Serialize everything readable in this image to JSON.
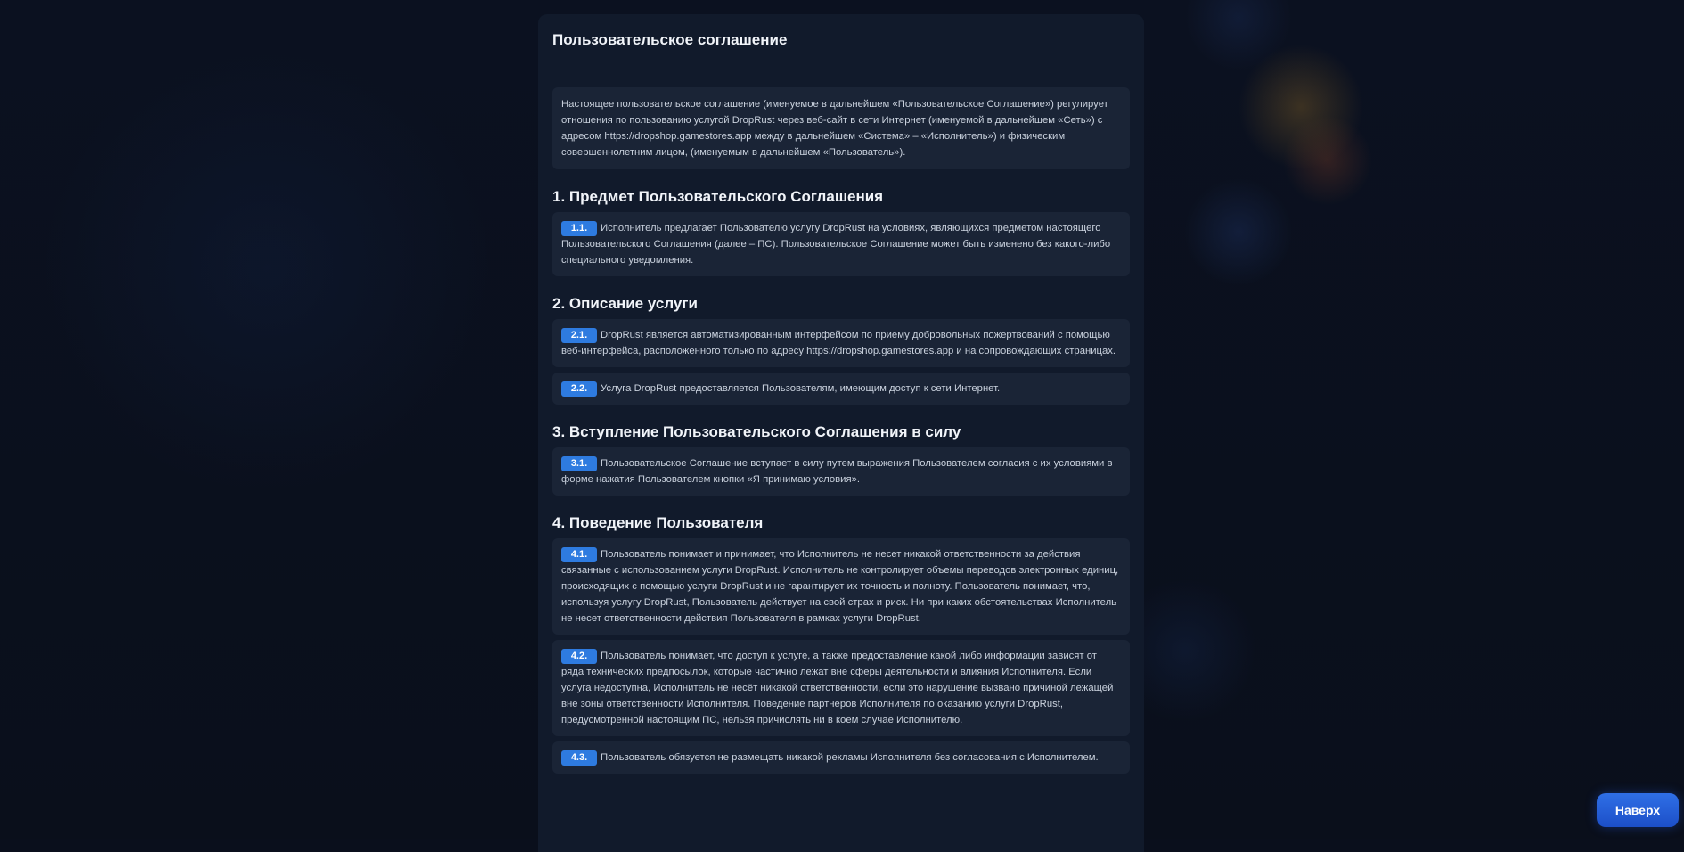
{
  "page": {
    "title": "Пользовательское соглашение",
    "intro": "Настоящее пользовательское соглашение (именуемое в дальнейшем «Пользовательское Соглашение») регулирует отношения по пользованию услугой DropRust через веб-сайт в сети Интернет (именуемой в дальнейшем «Сеть») с адресом https://dropshop.gamestores.app между в дальнейшем «Система» – «Исполнитель») и физическим совершеннолетним лицом, (именуемым в дальнейшем «Пользователь»)."
  },
  "sections": [
    {
      "title": "1. Предмет Пользовательского Соглашения",
      "items": [
        {
          "num": "1.1.",
          "text": "Исполнитель предлагает Пользователю услугу DropRust на условиях, являющихся предметом настоящего Пользовательского Соглашения (далее – ПС). Пользовательское Соглашение может быть изменено без какого-либо специального уведомления."
        }
      ]
    },
    {
      "title": "2. Описание услуги",
      "items": [
        {
          "num": "2.1.",
          "text": "DropRust является автоматизированным интерфейсом по приему добровольных пожертвований с помощью веб-интерфейса, расположенного только по адресу https://dropshop.gamestores.app и на сопровождающих страницах."
        },
        {
          "num": "2.2.",
          "text": "Услуга DropRust предоставляется Пользователям, имеющим доступ к сети Интернет."
        }
      ]
    },
    {
      "title": "3. Вступление Пользовательского Соглашения в силу",
      "items": [
        {
          "num": "3.1.",
          "text": "Пользовательское Соглашение вступает в силу путем выражения Пользователем согласия с их условиями в форме нажатия Пользователем кнопки «Я принимаю условия»."
        }
      ]
    },
    {
      "title": "4. Поведение Пользователя",
      "items": [
        {
          "num": "4.1.",
          "text": "Пользователь понимает и принимает, что Исполнитель не несет никакой ответственности за действия связанные с использованием услуги DropRust. Исполнитель не контролирует объемы переводов электронных единиц, происходящих с помощью услуги DropRust и не гарантирует их точность и полноту. Пользователь понимает, что, используя услугу DropRust, Пользователь действует на свой страх и риск. Ни при каких обстоятельствах Исполнитель не несет ответственности действия Пользователя в рамках услуги DropRust."
        },
        {
          "num": "4.2.",
          "text": "Пользователь понимает, что доступ к услуге, а также предоставление какой либо информации зависят от ряда технических предпосылок, которые частично лежат вне сферы деятельности и влияния Исполнителя. Если услуга недоступна, Исполнитель не несёт никакой ответственности, если это нарушение вызвано причиной лежащей вне зоны ответственности Исполнителя. Поведение партнеров Исполнителя по оказанию услуги DropRust, предусмотренной настоящим ПС, нельзя причислять ни в коем случае Исполнителю."
        },
        {
          "num": "4.3.",
          "text": "Пользователь обязуется не размещать никакой рекламы Исполнителя без согласования с Исполнителем."
        }
      ]
    }
  ],
  "to_top": {
    "label": "Наверх"
  },
  "colors": {
    "accent": "#2e7be0",
    "panel": "#111a2b",
    "card": "#1a2436",
    "background": "#0a0f1c"
  }
}
